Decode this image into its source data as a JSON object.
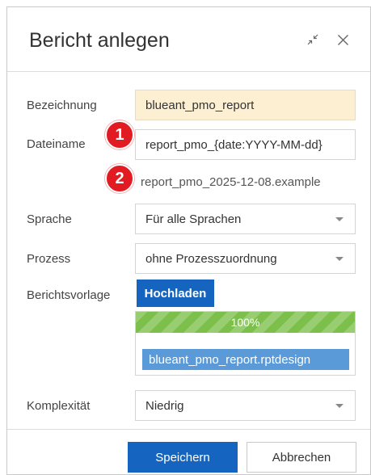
{
  "dialog": {
    "title": "Bericht anlegen",
    "collapse_icon": "collapse-arrows-icon",
    "close_icon": "close-icon"
  },
  "form": {
    "bezeichnung": {
      "label": "Bezeichnung",
      "value": "blueant_pmo_report"
    },
    "dateiname": {
      "label": "Dateiname",
      "value": "report_pmo_{date:YYYY-MM-dd}",
      "preview": "report_pmo_2025-12-08.example"
    },
    "sprache": {
      "label": "Sprache",
      "value": "Für alle Sprachen"
    },
    "prozess": {
      "label": "Prozess",
      "value": "ohne Prozesszuordnung"
    },
    "berichtsvorlage": {
      "label": "Berichtsvorlage",
      "upload_label": "Hochladen",
      "progress_text": "100%",
      "progress_value": 100,
      "file_name": "blueant_pmo_report.rptdesign"
    },
    "komplexitaet": {
      "label": "Komplexität",
      "value": "Niedrig"
    }
  },
  "badges": {
    "one": "1",
    "two": "2",
    "color": "#e21b23"
  },
  "footer": {
    "save_label": "Speichern",
    "cancel_label": "Abbrechen"
  },
  "colors": {
    "primary": "#1565c0",
    "highlight": "#fcefd2",
    "progress": "#7cbf4a",
    "file_chip": "#5b9ad8"
  }
}
